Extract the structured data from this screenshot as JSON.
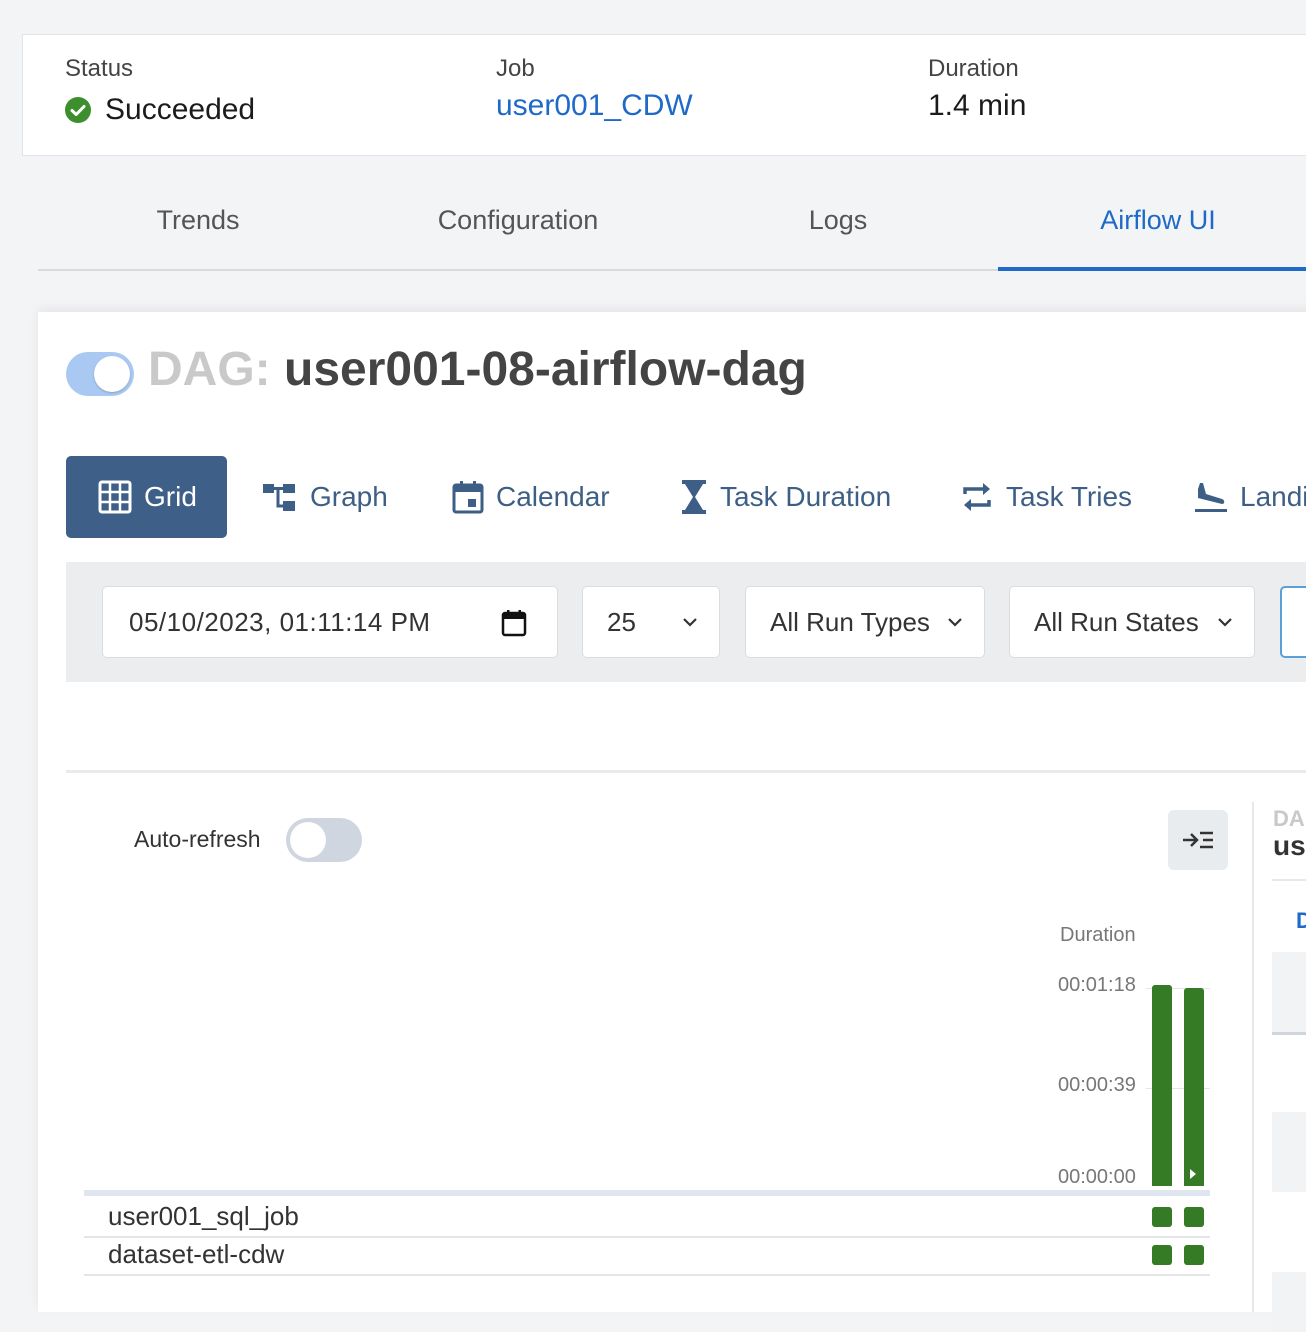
{
  "summary": {
    "status_label": "Status",
    "status_value": "Succeeded",
    "job_label": "Job",
    "job_value": "user001_CDW",
    "duration_label": "Duration",
    "duration_value": "1.4 min",
    "status_color": "#3d8f2d"
  },
  "tabs": [
    {
      "label": "Trends",
      "active": false
    },
    {
      "label": "Configuration",
      "active": false
    },
    {
      "label": "Logs",
      "active": false
    },
    {
      "label": "Airflow UI",
      "active": true
    }
  ],
  "dag": {
    "prefix": "DAG:",
    "name": "user001-08-airflow-dag",
    "paused": false
  },
  "views": [
    {
      "label": "Grid",
      "icon": "grid-icon",
      "active": true
    },
    {
      "label": "Graph",
      "icon": "graph-icon"
    },
    {
      "label": "Calendar",
      "icon": "calendar-icon"
    },
    {
      "label": "Task Duration",
      "icon": "hourglass-icon"
    },
    {
      "label": "Task Tries",
      "icon": "repeat-icon"
    },
    {
      "label": "Landi",
      "icon": "landing-icon"
    }
  ],
  "filters": {
    "datetime": "05/10/2023, 01:11:14 PM",
    "num_runs": "25",
    "run_types": "All Run Types",
    "run_states": "All Run States"
  },
  "grid": {
    "auto_refresh_label": "Auto-refresh",
    "auto_refresh_on": false,
    "duration_label": "Duration",
    "ticks": [
      "00:01:18",
      "00:00:39",
      "00:00:00"
    ],
    "runs": [
      {
        "duration_seconds": 79
      },
      {
        "duration_seconds": 78
      }
    ],
    "tasks": [
      {
        "name": "user001_sql_job",
        "states": [
          "success",
          "success"
        ]
      },
      {
        "name": "dataset-etl-cdw",
        "states": [
          "success",
          "success"
        ]
      }
    ],
    "success_color": "#357a25"
  },
  "details_panel": {
    "prefix": "DA",
    "name": "us",
    "tab_initial": "D"
  }
}
